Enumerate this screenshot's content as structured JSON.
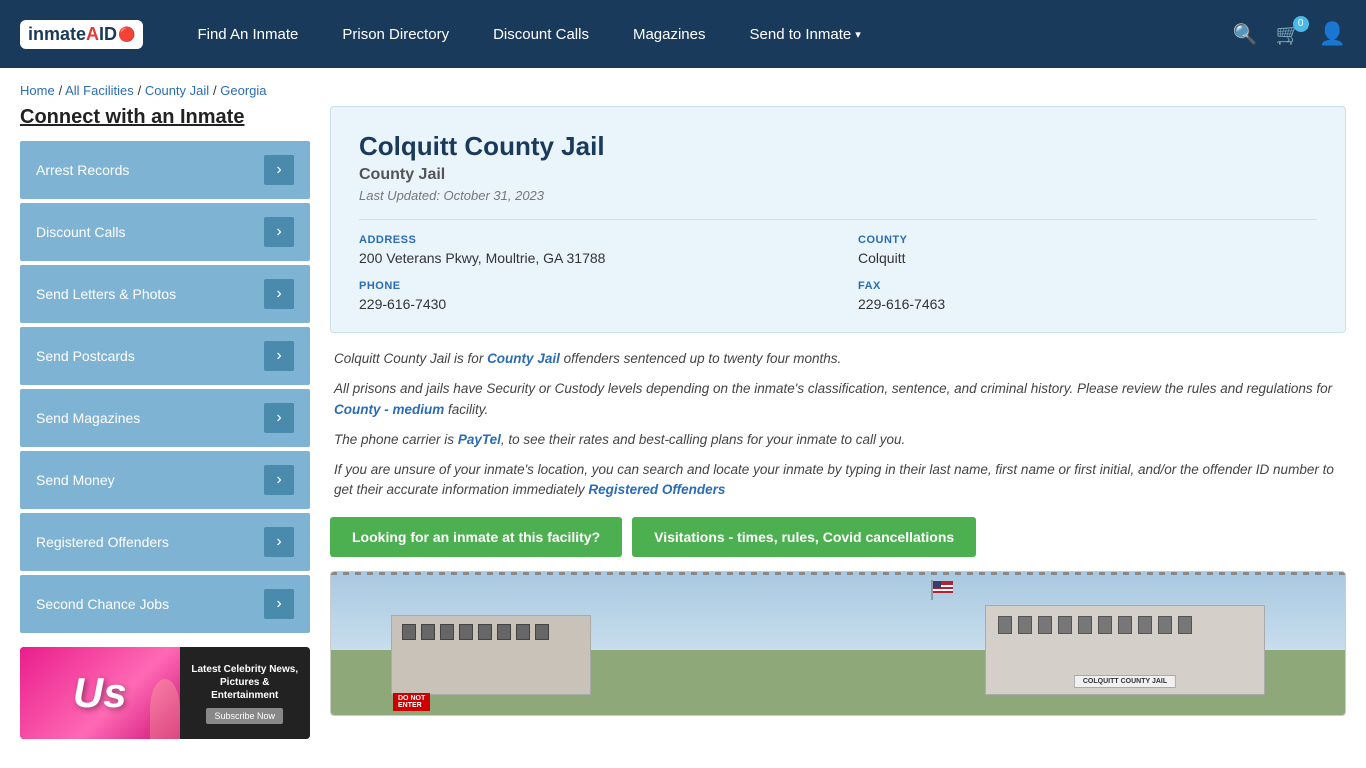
{
  "header": {
    "logo_text": "inmateAID",
    "nav": [
      {
        "label": "Find An Inmate",
        "id": "find-inmate",
        "hasArrow": false
      },
      {
        "label": "Prison Directory",
        "id": "prison-directory",
        "hasArrow": false
      },
      {
        "label": "Discount Calls",
        "id": "discount-calls",
        "hasArrow": false
      },
      {
        "label": "Magazines",
        "id": "magazines",
        "hasArrow": false
      },
      {
        "label": "Send to Inmate",
        "id": "send-to-inmate",
        "hasArrow": true
      }
    ],
    "cart_count": "0"
  },
  "breadcrumb": {
    "home": "Home",
    "all_facilities": "All Facilities",
    "county_jail": "County Jail",
    "state": "Georgia"
  },
  "sidebar": {
    "title": "Connect with an Inmate",
    "items": [
      {
        "label": "Arrest Records",
        "id": "arrest-records"
      },
      {
        "label": "Discount Calls",
        "id": "discount-calls-side"
      },
      {
        "label": "Send Letters & Photos",
        "id": "send-letters"
      },
      {
        "label": "Send Postcards",
        "id": "send-postcards"
      },
      {
        "label": "Send Magazines",
        "id": "send-magazines"
      },
      {
        "label": "Send Money",
        "id": "send-money"
      },
      {
        "label": "Registered Offenders",
        "id": "registered-offenders"
      },
      {
        "label": "Second Chance Jobs",
        "id": "second-chance-jobs"
      }
    ],
    "ad": {
      "logo": "Us",
      "title": "Latest Celebrity News, Pictures & Entertainment",
      "subscribe": "Subscribe Now"
    }
  },
  "facility": {
    "name": "Colquitt County Jail",
    "type": "County Jail",
    "last_updated": "Last Updated: October 31, 2023",
    "address_label": "ADDRESS",
    "address_value": "200 Veterans Pkwy, Moultrie, GA 31788",
    "county_label": "COUNTY",
    "county_value": "Colquitt",
    "phone_label": "PHONE",
    "phone_value": "229-616-7430",
    "fax_label": "FAX",
    "fax_value": "229-616-7463",
    "desc1": "Colquitt County Jail is for County Jail offenders sentenced up to twenty four months.",
    "desc1_link": "County Jail",
    "desc2": "All prisons and jails have Security or Custody levels depending on the inmate's classification, sentence, and criminal history. Please review the rules and regulations for County - medium facility.",
    "desc2_link": "County - medium",
    "desc3": "The phone carrier is PayTel, to see their rates and best-calling plans for your inmate to call you.",
    "desc3_link": "PayTel",
    "desc4": "If you are unsure of your inmate's location, you can search and locate your inmate by typing in their last name, first name or first initial, and/or the offender ID number to get their accurate information immediately Registered Offenders",
    "desc4_link": "Registered Offenders",
    "btn_looking": "Looking for an inmate at this facility?",
    "btn_visitation": "Visitations - times, rules, Covid cancellations",
    "image_sign": "COLQUITT COUNTY JAIL"
  }
}
